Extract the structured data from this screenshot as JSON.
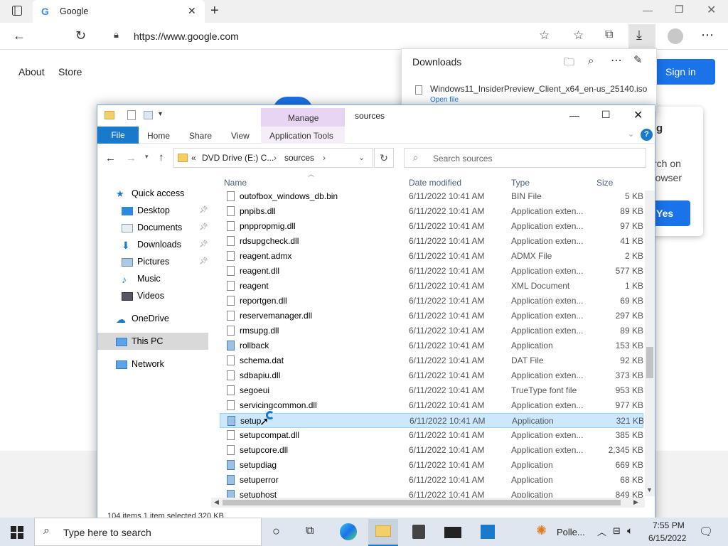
{
  "browser": {
    "tab_title": "Google",
    "url": "https://www.google.com"
  },
  "google": {
    "links": [
      "About",
      "Store"
    ],
    "sign_in": "Sign in",
    "card_line1": "g",
    "card_line2": "rch on",
    "card_line3": "rowser",
    "card_yes": "Yes"
  },
  "downloads": {
    "title": "Downloads",
    "file": "Windows11_InsiderPreview_Client_x64_en-us_25140.iso",
    "open_file": "Open file"
  },
  "explorer": {
    "manage": "Manage",
    "title": "sources",
    "ribbon_tabs": [
      "File",
      "Home",
      "Share",
      "View",
      "Application Tools"
    ],
    "breadcrumb": [
      "«",
      "DVD Drive (E:) C...",
      "›",
      "sources",
      "›"
    ],
    "search_placeholder": "Search sources",
    "columns": [
      "Name",
      "Date modified",
      "Type",
      "Size"
    ],
    "nav": [
      {
        "label": "Quick access",
        "icon": "star-icon",
        "pinned": false
      },
      {
        "label": "Desktop",
        "icon": "desktop-icon",
        "pinned": true
      },
      {
        "label": "Documents",
        "icon": "documents-icon",
        "pinned": true
      },
      {
        "label": "Downloads",
        "icon": "downloads-icon",
        "pinned": true
      },
      {
        "label": "Pictures",
        "icon": "pictures-icon",
        "pinned": true
      },
      {
        "label": "Music",
        "icon": "music-icon",
        "pinned": false
      },
      {
        "label": "Videos",
        "icon": "videos-icon",
        "pinned": false
      },
      {
        "label": "OneDrive",
        "icon": "cloud-icon",
        "pinned": false
      },
      {
        "label": "This PC",
        "icon": "computer-icon",
        "pinned": false
      },
      {
        "label": "Network",
        "icon": "network-icon",
        "pinned": false
      }
    ],
    "files": [
      {
        "name": "outofbox_windows_db.bin",
        "date": "6/11/2022 10:41 AM",
        "type": "BIN File",
        "size": "5 KB"
      },
      {
        "name": "pnpibs.dll",
        "date": "6/11/2022 10:41 AM",
        "type": "Application exten...",
        "size": "89 KB"
      },
      {
        "name": "pnppropmig.dll",
        "date": "6/11/2022 10:41 AM",
        "type": "Application exten...",
        "size": "97 KB"
      },
      {
        "name": "rdsupgcheck.dll",
        "date": "6/11/2022 10:41 AM",
        "type": "Application exten...",
        "size": "41 KB"
      },
      {
        "name": "reagent.admx",
        "date": "6/11/2022 10:41 AM",
        "type": "ADMX File",
        "size": "2 KB"
      },
      {
        "name": "reagent.dll",
        "date": "6/11/2022 10:41 AM",
        "type": "Application exten...",
        "size": "577 KB"
      },
      {
        "name": "reagent",
        "date": "6/11/2022 10:41 AM",
        "type": "XML Document",
        "size": "1 KB"
      },
      {
        "name": "reportgen.dll",
        "date": "6/11/2022 10:41 AM",
        "type": "Application exten...",
        "size": "69 KB"
      },
      {
        "name": "reservemanager.dll",
        "date": "6/11/2022 10:41 AM",
        "type": "Application exten...",
        "size": "297 KB"
      },
      {
        "name": "rmsupg.dll",
        "date": "6/11/2022 10:41 AM",
        "type": "Application exten...",
        "size": "89 KB"
      },
      {
        "name": "rollback",
        "date": "6/11/2022 10:41 AM",
        "type": "Application",
        "size": "153 KB"
      },
      {
        "name": "schema.dat",
        "date": "6/11/2022 10:41 AM",
        "type": "DAT File",
        "size": "92 KB"
      },
      {
        "name": "sdbapiu.dll",
        "date": "6/11/2022 10:41 AM",
        "type": "Application exten...",
        "size": "373 KB"
      },
      {
        "name": "segoeui",
        "date": "6/11/2022 10:41 AM",
        "type": "TrueType font file",
        "size": "953 KB"
      },
      {
        "name": "servicingcommon.dll",
        "date": "6/11/2022 10:41 AM",
        "type": "Application exten...",
        "size": "977 KB"
      },
      {
        "name": "setup",
        "date": "6/11/2022 10:41 AM",
        "type": "Application",
        "size": "321 KB",
        "selected": true
      },
      {
        "name": "setupcompat.dll",
        "date": "6/11/2022 10:41 AM",
        "type": "Application exten...",
        "size": "385 KB"
      },
      {
        "name": "setupcore.dll",
        "date": "6/11/2022 10:41 AM",
        "type": "Application exten...",
        "size": "2,345 KB"
      },
      {
        "name": "setupdiag",
        "date": "6/11/2022 10:41 AM",
        "type": "Application",
        "size": "669 KB"
      },
      {
        "name": "setuperror",
        "date": "6/11/2022 10:41 AM",
        "type": "Application",
        "size": "68 KB"
      },
      {
        "name": "setuphost",
        "date": "6/11/2022 10:41 AM",
        "type": "Application",
        "size": "849 KB"
      }
    ],
    "status": "104 items    1 item selected  320 KB"
  },
  "taskbar": {
    "search_placeholder": "Type here to search",
    "weather": "Polle...",
    "time": "7:55 PM",
    "date": "6/15/2022"
  },
  "colors": {
    "accent": "#1a73e8",
    "selection": "#cce8ff",
    "file_tab": "#1979ca",
    "manage": "#e8d4f3"
  }
}
